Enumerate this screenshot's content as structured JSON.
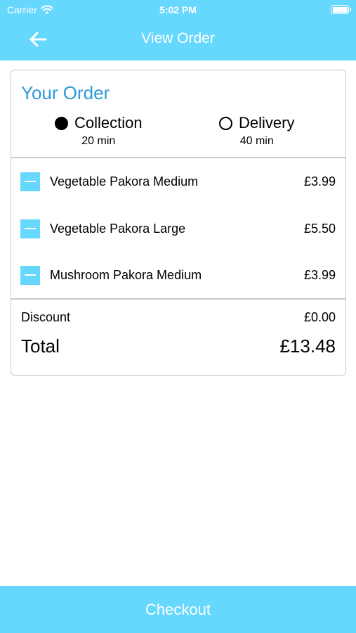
{
  "status_bar": {
    "carrier": "Carrier",
    "time": "5:02 PM"
  },
  "nav": {
    "title": "View Order",
    "back_icon": "arrow-left-icon"
  },
  "order": {
    "heading": "Your Order",
    "options": [
      {
        "label": "Collection",
        "time": "20 min",
        "selected": true
      },
      {
        "label": "Delivery",
        "time": "40 min",
        "selected": false
      }
    ],
    "items": [
      {
        "name": "Vegetable Pakora Medium",
        "price": "£3.99"
      },
      {
        "name": "Vegetable Pakora Large",
        "price": "£5.50"
      },
      {
        "name": "Mushroom Pakora Medium",
        "price": "£3.99"
      }
    ],
    "discount_label": "Discount",
    "discount_value": "£0.00",
    "total_label": "Total",
    "total_value": "£13.48"
  },
  "checkout_label": "Checkout",
  "colors": {
    "primary": "#66d7fd",
    "heading": "#2b9bd7",
    "border": "#c8c8c8"
  }
}
